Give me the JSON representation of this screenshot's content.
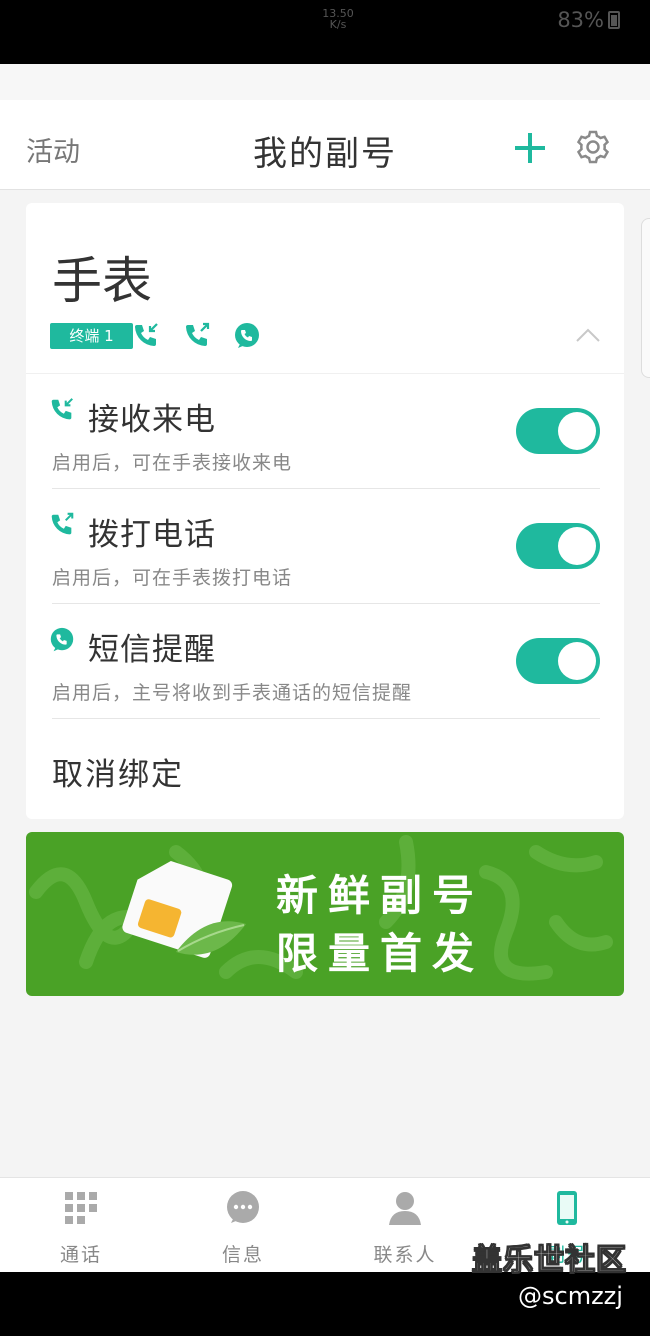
{
  "status_bar": {
    "speed_value": "13.50",
    "speed_unit": "K/s",
    "battery": "83%"
  },
  "header": {
    "left_label": "活动",
    "title": "我的副号"
  },
  "device": {
    "name": "手表",
    "badge": "终端 1"
  },
  "settings": [
    {
      "title": "接收来电",
      "desc": "启用后，可在手表接收来电",
      "enabled": true,
      "icon": "incoming-call-icon"
    },
    {
      "title": "拨打电话",
      "desc": "启用后，可在手表拨打电话",
      "enabled": true,
      "icon": "outgoing-call-icon"
    },
    {
      "title": "短信提醒",
      "desc": "启用后，主号将收到手表通话的短信提醒",
      "enabled": true,
      "icon": "sms-icon"
    }
  ],
  "unbind_label": "取消绑定",
  "banner": {
    "line1": "新鲜副号",
    "line2": "限量首发"
  },
  "nav": [
    {
      "label": "通话",
      "icon": "dialpad-icon"
    },
    {
      "label": "信息",
      "icon": "message-icon"
    },
    {
      "label": "联系人",
      "icon": "contacts-icon"
    },
    {
      "label": "副号",
      "icon": "phone-icon",
      "active": true
    }
  ],
  "watermark": {
    "cn": "盖乐世社区",
    "handle": "@scmzzj"
  },
  "colors": {
    "accent": "#1fb99e",
    "banner_green": "#4aa226"
  }
}
